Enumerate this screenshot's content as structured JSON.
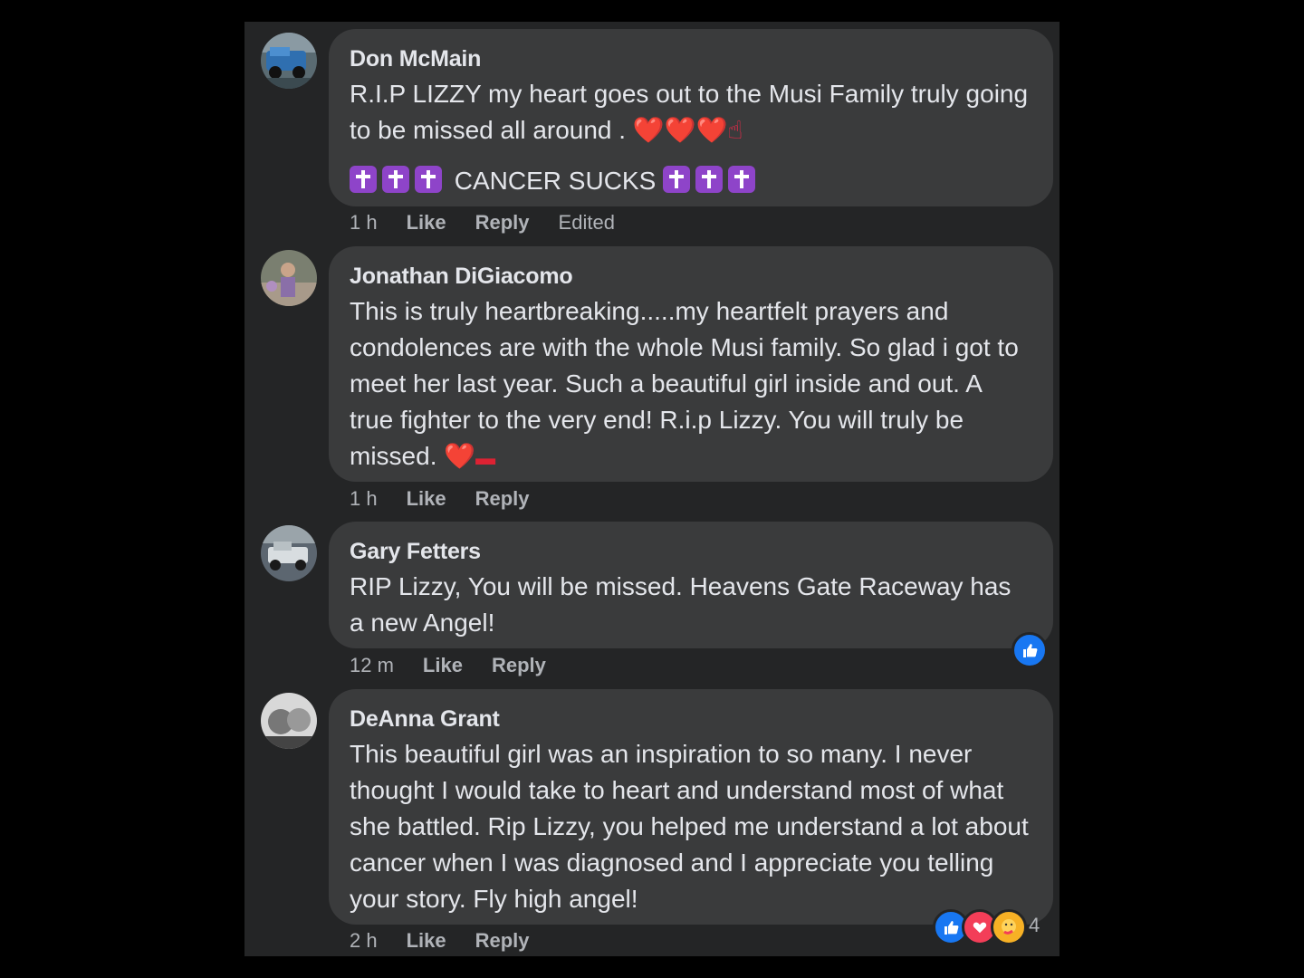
{
  "comments": [
    {
      "author": "Don McMain",
      "text": "R.I.P LIZZY my heart goes out to the Musi Family truly going to be missed all around .",
      "text_emoji": "❤️❤️❤️☝",
      "second_line": "CANCER SUCKS",
      "time": "1 h",
      "like": "Like",
      "reply": "Reply",
      "edited": "Edited"
    },
    {
      "author": "Jonathan DiGiacomo",
      "text": "This is truly heartbreaking.....my heartfelt prayers and condolences are with the whole Musi family. So glad i got to meet her last year. Such a beautiful girl inside and out. A true fighter to the very end! R.i.p Lizzy. You will truly be missed.",
      "text_emoji": "❤️",
      "time": "1 h",
      "like": "Like",
      "reply": "Reply"
    },
    {
      "author": "Gary Fetters",
      "text": "RIP Lizzy, You will be missed. Heavens Gate Raceway has a new Angel!",
      "time": "12 m",
      "like": "Like",
      "reply": "Reply",
      "reactions": [
        "like-icon"
      ]
    },
    {
      "author": "DeAnna Grant",
      "text": "This beautiful girl was an inspiration to so many. I never thought I would take to heart and understand most of what she battled. Rip Lizzy, you helped me understand a lot about cancer when I was diagnosed and I appreciate you telling your story. Fly high angel!",
      "time": "2 h",
      "like": "Like",
      "reply": "Reply",
      "reactions": [
        "like-icon",
        "heart-icon",
        "care-icon"
      ],
      "reaction_count": "4"
    }
  ],
  "colors": {
    "background": "#000000",
    "panel": "#242526",
    "bubble": "#3a3b3c",
    "text": "#e4e6eb",
    "meta": "#b0b3b8",
    "like_blue": "#1877f2"
  }
}
